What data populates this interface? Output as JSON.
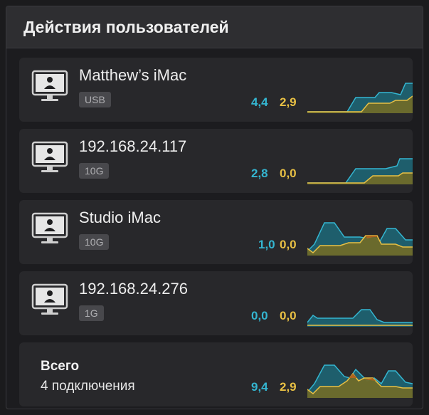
{
  "header": {
    "title": "Действия пользователей"
  },
  "colors": {
    "upload": "#34b6d1",
    "download": "#e8c044"
  },
  "connections": [
    {
      "name": "Matthew’s iMac",
      "badge": "USB",
      "v1": "4,4",
      "v2": "2,9",
      "icon": "monitor-user-icon"
    },
    {
      "name": "192.168.24.117",
      "badge": "10G",
      "v1": "2,8",
      "v2": "0,0",
      "icon": "monitor-user-icon"
    },
    {
      "name": "Studio iMac",
      "badge": "10G",
      "v1": "1,0",
      "v2": "0,0",
      "icon": "monitor-user-icon"
    },
    {
      "name": "192.168.24.276",
      "badge": "1G",
      "v1": "0,0",
      "v2": "0,0",
      "icon": "monitor-user-icon"
    }
  ],
  "total": {
    "label": "Всего",
    "sublabel": "4 подключения",
    "v1": "9,4",
    "v2": "2,9"
  }
}
